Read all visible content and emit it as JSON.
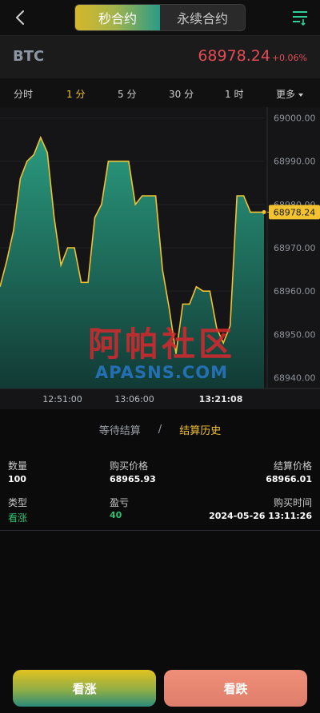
{
  "header": {
    "tabs": [
      {
        "label": "秒合约",
        "active": true
      },
      {
        "label": "永续合约",
        "active": false
      }
    ]
  },
  "ticker": {
    "symbol": "BTC",
    "price": "68978.24",
    "change_pct": "+0.06%",
    "color_down": "#e34b55"
  },
  "periods": [
    {
      "label": "分时",
      "active": false
    },
    {
      "label": "1 分",
      "active": true
    },
    {
      "label": "5 分",
      "active": false
    },
    {
      "label": "30 分",
      "active": false
    },
    {
      "label": "1 时",
      "active": false
    },
    {
      "label": "更多",
      "active": false
    }
  ],
  "chart_data": {
    "type": "area",
    "y_ticks": [
      "69000.00",
      "68990.00",
      "68980.00",
      "68970.00",
      "68960.00",
      "68950.00",
      "68940.00"
    ],
    "ylim": [
      68937.5,
      69002.5
    ],
    "x_ticks": [
      "12:51:00",
      "13:06:00",
      "13:21:08"
    ],
    "current_price_label": "68978.24",
    "current_price": 68978.24,
    "series": [
      {
        "values": [
          68961,
          68967,
          68974,
          68986,
          68990,
          68991.5,
          68995.5,
          68992,
          68977,
          68966,
          68970,
          68970,
          68962,
          68962,
          68977,
          68980,
          68990,
          68990,
          68990,
          68990,
          68980,
          68982,
          68982,
          68982,
          68965,
          68956,
          68945.5,
          68957,
          68957,
          68961,
          68960,
          68960,
          68951.5,
          68948,
          68952,
          68982,
          68982,
          68978.24,
          68978.24,
          68978.24
        ]
      }
    ],
    "line_color": "#f2c230",
    "fill_top": "#2a9a7e",
    "fill_bottom": "#123a35"
  },
  "watermark": {
    "cn": "阿帕社区",
    "en": "APASNS.COM"
  },
  "settlement_tabs": {
    "pending": "等待结算",
    "separator": "/",
    "history": "结算历史"
  },
  "record": {
    "qty_label": "数量",
    "qty": "100",
    "buy_price_label": "购买价格",
    "buy_price": "68965.93",
    "settle_price_label": "结算价格",
    "settle_price": "68966.01",
    "type_label": "类型",
    "type": "看涨",
    "pnl_label": "盈亏",
    "pnl": "40",
    "buy_time_label": "购买时间",
    "buy_time": "2024-05-26 13:11:26"
  },
  "actions": {
    "up": "看涨",
    "down": "看跌"
  }
}
